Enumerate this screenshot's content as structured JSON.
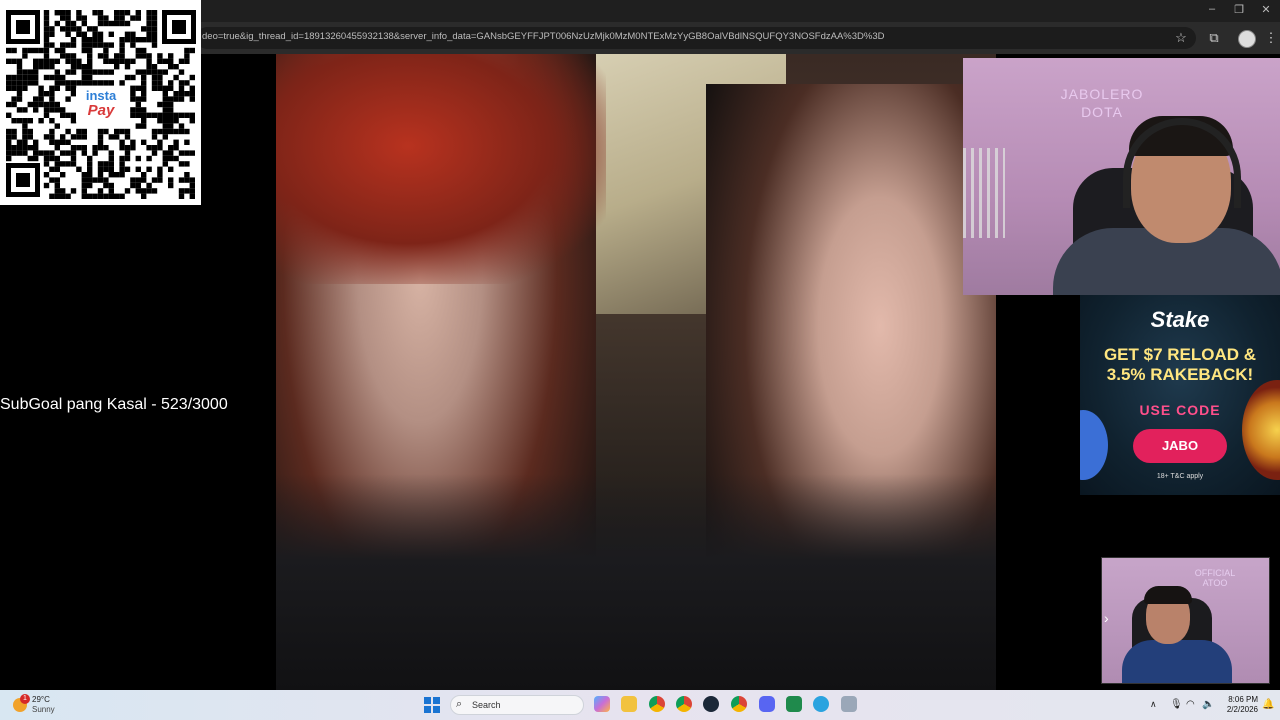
{
  "browser": {
    "address_url": "deo=true&ig_thread_id=18913260455932138&server_info_data=GANsbGEYFFJPT006NzUzMjk0MzM0NTExMzYyGB8OalVBdlNSQUFQY3NOSFdzAA%3D%3D"
  },
  "overlay": {
    "subgoal_text": "SubGoal pang Kasal - 523/3000",
    "qr_logo_line1": "insta",
    "qr_logo_line2": "Pay"
  },
  "webcam": {
    "wall_text_line1": "JABOLERO",
    "wall_text_line2": "DOTA"
  },
  "ad": {
    "brand": "Stake",
    "headline_line1": "GET $7 RELOAD &",
    "headline_line2": "3.5% RAKEBACK!",
    "use_code_label": "USE CODE",
    "code": "JABO",
    "terms": "18+  T&C apply"
  },
  "cam2": {
    "wall_text_line1": "OFFICIAL",
    "wall_text_line2": "ATOO"
  },
  "taskbar": {
    "weather_temp": "29°C",
    "weather_condition": "Sunny",
    "weather_badge": "1",
    "search_placeholder": "Search",
    "time": "8:06 PM",
    "date": "2/2/2026",
    "apps": [
      "copilot-app",
      "file-explorer",
      "chrome-profile-1",
      "chrome",
      "steam",
      "chrome-profile-2",
      "discord",
      "app-green",
      "telegram",
      "app-misc"
    ]
  },
  "colors": {
    "ad_button": "#e2215c",
    "ad_headline": "#ffe680",
    "windows_accent": "#1a74d2"
  }
}
